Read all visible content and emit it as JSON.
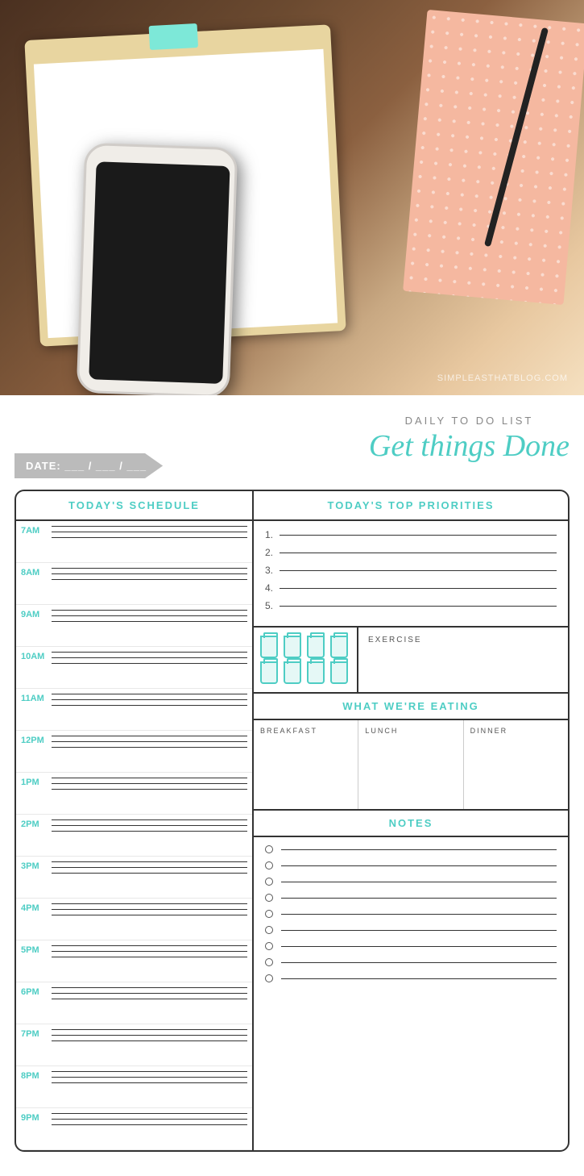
{
  "photo": {
    "watermark": "SIMPLEASTHATBLOG.COM"
  },
  "planner": {
    "date_label": "DATE:",
    "date_blanks": "___ / ___ / ___",
    "subtitle": "DAILY TO DO LIST",
    "title": "Get things Done",
    "schedule_header": "TODAY'S SCHEDULE",
    "priorities_header": "TODAY'S TOP PRIORITIES",
    "exercise_label": "EXERCISE",
    "eating_header": "WHAT WE'RE EATING",
    "notes_header": "NOTES",
    "time_slots": [
      "7AM",
      "8AM",
      "9AM",
      "10AM",
      "11AM",
      "12PM",
      "1PM",
      "2PM",
      "3PM",
      "4PM",
      "5PM",
      "6PM",
      "7PM",
      "8PM",
      "9PM"
    ],
    "priority_numbers": [
      "1.",
      "2.",
      "3.",
      "4.",
      "5."
    ],
    "meal_labels": [
      "BREAKFAST",
      "LUNCH",
      "DINNER"
    ],
    "notes_count": 9
  }
}
